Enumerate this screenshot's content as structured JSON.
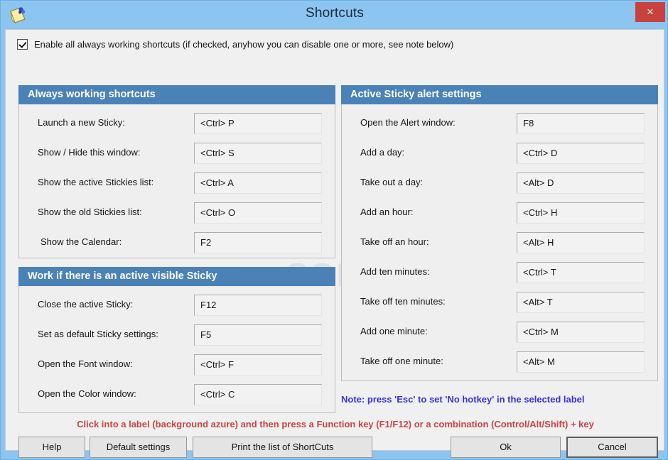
{
  "window": {
    "title": "Shortcuts",
    "app_icon": "sticky-note-icon",
    "close_label": "×",
    "frame_color": "#8cc5f0",
    "close_color": "#c8413e"
  },
  "enable": {
    "checked": true,
    "label": "Enable all always working shortcuts (if checked, anyhow you can disable one or more, see note below)"
  },
  "panels": {
    "always": {
      "title": "Always working shortcuts",
      "header_color": "#4a82b8",
      "rows": [
        {
          "label": "Launch a new Sticky:",
          "value": "<Ctrl> P"
        },
        {
          "label": "Show / Hide this window:",
          "value": "<Ctrl> S"
        },
        {
          "label": "Show the active Stickies list:",
          "value": "<Ctrl> A"
        },
        {
          "label": "Show the old Stickies list:",
          "value": "<Ctrl> O"
        },
        {
          "label": "Show the Calendar:",
          "value": "F2"
        }
      ]
    },
    "visible": {
      "title": "Work if there is an active visible Sticky",
      "header_color": "#4a82b8",
      "rows": [
        {
          "label": "Close the active Sticky:",
          "value": "F12"
        },
        {
          "label": "Set as default Sticky settings:",
          "value": "F5"
        },
        {
          "label": "Open the Font window:",
          "value": "<Ctrl> F"
        },
        {
          "label": "Open the Color window:",
          "value": "<Ctrl> C"
        }
      ]
    },
    "alert": {
      "title": "Active Sticky alert settings",
      "header_color": "#4a82b8",
      "rows": [
        {
          "label": "Open the Alert window:",
          "value": "F8"
        },
        {
          "label": "Add a day:",
          "value": "<Ctrl> D"
        },
        {
          "label": "Take out a day:",
          "value": "<Alt> D"
        },
        {
          "label": "Add an hour:",
          "value": "<Ctrl> H"
        },
        {
          "label": "Take off an hour:",
          "value": "<Alt> H"
        },
        {
          "label": "Add ten minutes:",
          "value": "<Ctrl> T"
        },
        {
          "label": "Take off ten minutes:",
          "value": "<Alt> T"
        },
        {
          "label": "Add one minute:",
          "value": "<Ctrl> M"
        },
        {
          "label": "Take off one minute:",
          "value": "<Alt> M"
        }
      ]
    }
  },
  "notes": {
    "esc": "Note: press 'Esc' to set 'No hotkey' in the selected label",
    "esc_color": "#3832e6",
    "click": "Click into a label (background azure) and then press a Function key (F1/F12) or a combination (Control/Alt/Shift) + key",
    "click_color": "#cc4444"
  },
  "buttons": {
    "help": "Help",
    "default_settings": "Default settings",
    "print": "Print the list of ShortCuts",
    "ok": "Ok",
    "cancel": "Cancel"
  },
  "watermark": "SOFTPEDIA"
}
